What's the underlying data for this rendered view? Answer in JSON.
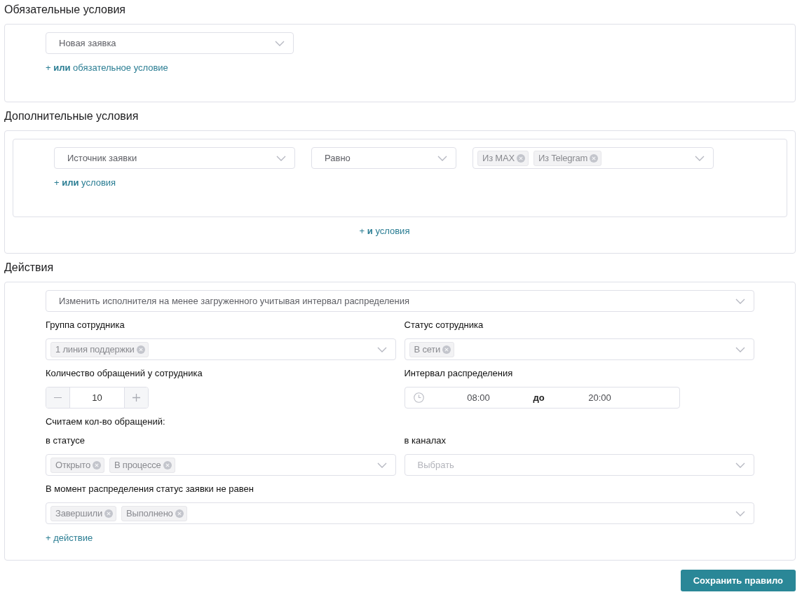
{
  "required_conditions": {
    "title": "Обязательные условия",
    "select": {
      "value": "Новая заявка"
    },
    "add_link": "+ **или** обязательное условие"
  },
  "additional_conditions": {
    "title": "Дополнительные условия",
    "groups": [
      {
        "conditions": [
          {
            "field": "Источник заявки",
            "operator": "Равно",
            "values": [
              "Из MAX",
              "Из Telegram"
            ]
          }
        ],
        "add_link": "+ **или** условия"
      }
    ],
    "add_link": "+ **и** условия"
  },
  "actions": {
    "title": "Действия",
    "items": [
      {
        "action": "Изменить исполнителя на менее загруженного учитывая интервал распределения",
        "rows": [
          [
            {
              "kind": "multiselect",
              "label": "Группа сотрудника",
              "values": [
                "1 линия поддержки"
              ]
            },
            {
              "kind": "multiselect",
              "label": "Статус сотрудника",
              "values": [
                "В сети"
              ]
            }
          ],
          [
            {
              "kind": "stepper",
              "label": "Количество обращений у сотрудника",
              "value": "10"
            },
            {
              "kind": "time_range",
              "label": "Интервал распределения",
              "from": "08:00",
              "separator": "до",
              "to": "20:00"
            }
          ],
          [
            {
              "kind": "heading",
              "label": "Считаем кол-во обращений:"
            }
          ],
          [
            {
              "kind": "multiselect",
              "label": "в статусе",
              "values": [
                "Открыто",
                "В процессе"
              ]
            },
            {
              "kind": "multiselect",
              "label": "в каналах",
              "placeholder": "Выбрать"
            }
          ],
          [
            {
              "kind": "multiselect",
              "label": "В момент распределения статус заявки не равен",
              "values": [
                "Завершили",
                "Выполнено"
              ]
            }
          ]
        ]
      }
    ],
    "add_link": "+ действие"
  },
  "save_button": "Сохранить правило"
}
